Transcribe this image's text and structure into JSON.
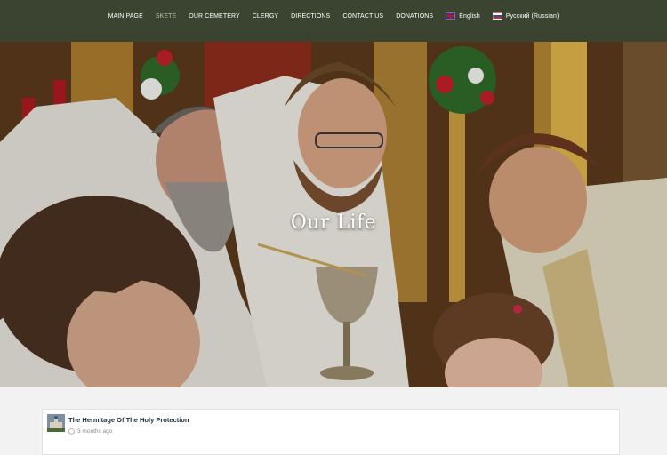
{
  "nav": {
    "items": [
      {
        "label": "MAIN PAGE",
        "active": false
      },
      {
        "label": "SKETE",
        "active": true
      },
      {
        "label": "OUR CEMETERY",
        "active": false
      },
      {
        "label": "CLERGY",
        "active": false
      },
      {
        "label": "DIRECTIONS",
        "active": false
      },
      {
        "label": "CONTACT US",
        "active": false
      },
      {
        "label": "DONATIONS",
        "active": false
      }
    ],
    "languages": [
      {
        "label": "English",
        "flag": "uk-flag-icon"
      },
      {
        "label": "Русский (Russian)",
        "flag": "ru-flag-icon"
      }
    ]
  },
  "hero": {
    "title": "Our Life"
  },
  "feed": {
    "post": {
      "title": "The Hermitage Of The Holy Protection",
      "time": "3 months ago"
    }
  },
  "colors": {
    "navbar": "#3a4430",
    "active_nav": "#b9c2a6",
    "background": "#f2f2f2"
  }
}
